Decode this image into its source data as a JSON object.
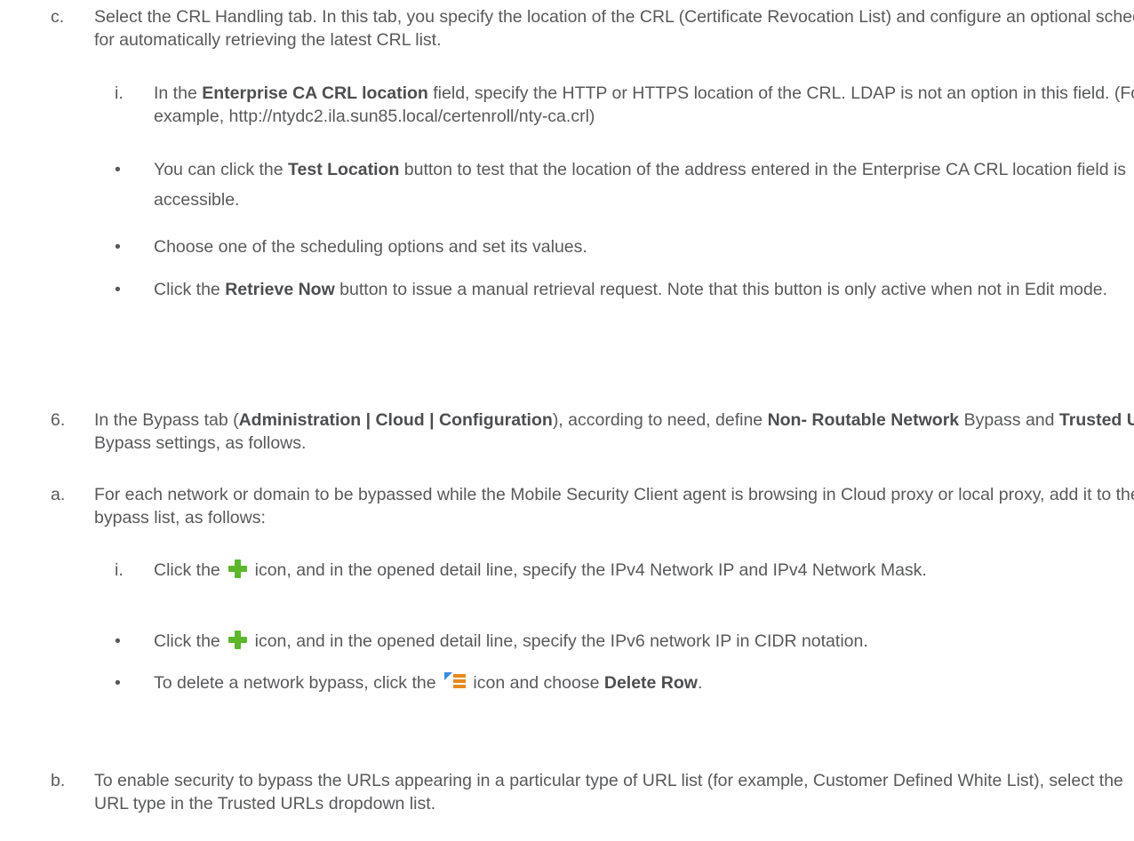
{
  "items": {
    "c": {
      "marker": "c.",
      "text": "Select the CRL Handling tab. In this tab, you specify the location of the CRL (Certificate Revocation List) and configure an optional schedule for automatically retrieving the latest CRL list."
    },
    "c_i": {
      "marker": "i.",
      "t1": "In the ",
      "b1": "Enterprise CA CRL location",
      "t2": " field, specify the HTTP or HTTPS location of the CRL. LDAP is not an option in this field. (For example, http://ntydc2.ila.sun85.local/certenroll/nty-ca.crl)"
    },
    "bullet_test": {
      "marker": "•",
      "t1": "You can click the ",
      "b1": "Test Location",
      "t2": " button to test that the location of the address entered in the Enterprise CA CRL location field is accessible."
    },
    "bullet_schedule": {
      "marker": "•",
      "text": "Choose one of the scheduling options and set its values."
    },
    "bullet_retrieve": {
      "marker": "•",
      "t1": "Click the ",
      "b1": "Retrieve Now",
      "t2": " button to issue a manual retrieval request. Note that this button is only active when not in Edit mode."
    },
    "step6": {
      "marker": "6.",
      "t1": "In the Bypass tab (",
      "b1": "Administration | Cloud | Configuration",
      "t2": "), according to need, define ",
      "b2": "Non- Routable Network",
      "t3": " Bypass and ",
      "b3": "Trusted URL",
      "t4": " Bypass settings, as follows."
    },
    "a": {
      "marker": "a.",
      "text": "For each network or domain to be bypassed while the Mobile Security Client agent is browsing in Cloud proxy or local proxy, add it to the bypass list, as follows:"
    },
    "a_i": {
      "marker": "i.",
      "t1": "Click the ",
      "icon": "plus-icon",
      "t2": " icon, and in the opened detail line, specify the IPv4 Network IP and IPv4 Network Mask."
    },
    "bullet_ipv6": {
      "marker": "•",
      "t1": "Click the ",
      "icon": "plus-icon",
      "t2": " icon, and in the opened detail line, specify the IPv6 network IP in CIDR notation."
    },
    "bullet_delete": {
      "marker": "•",
      "t1": "To delete a network bypass, click the ",
      "icon": "row-menu-icon",
      "t2": " icon and choose ",
      "b1": "Delete Row",
      "t3": "."
    },
    "b": {
      "marker": "b.",
      "text": "To enable security to bypass the URLs appearing in a particular type of URL list (for example, Customer Defined White List), select the URL type in the Trusted URLs dropdown list."
    }
  },
  "colors": {
    "text": "#58595b",
    "plus_icon": "#5cb82a",
    "menu_icon_arrow": "#3a8de0",
    "menu_icon_lines": "#e8891c"
  }
}
